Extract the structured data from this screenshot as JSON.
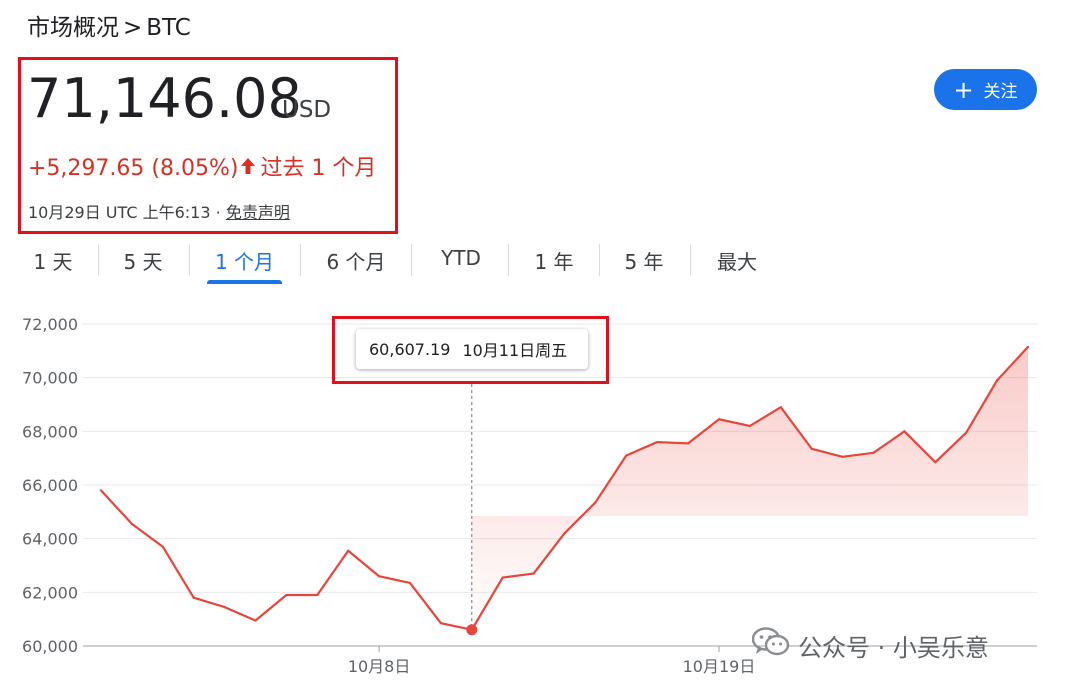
{
  "breadcrumb": {
    "parent": "市场概况",
    "separator": ">",
    "current": "BTC"
  },
  "quote": {
    "price": "71,146.08",
    "currency": "USD",
    "change": "+5,297.65 (8.05%)",
    "change_period": "过去 1 个月",
    "timestamp": "10月29日 UTC 上午6:13",
    "dot": "·",
    "disclaimer": "免责声明"
  },
  "follow_button": {
    "label": "关注"
  },
  "tabs": [
    {
      "label": "1 天",
      "active": false
    },
    {
      "label": "5 天",
      "active": false
    },
    {
      "label": "1 个月",
      "active": true
    },
    {
      "label": "6 个月",
      "active": false
    },
    {
      "label": "YTD",
      "active": false
    },
    {
      "label": "1 年",
      "active": false
    },
    {
      "label": "5 年",
      "active": false
    },
    {
      "label": "最大",
      "active": false
    }
  ],
  "tooltip": {
    "value": "60,607.19",
    "date": "10月11日周五"
  },
  "watermark": {
    "text": "公众号 · 小吴乐意"
  },
  "colors": {
    "line": "#e8453c",
    "accent": "#1a73e8",
    "highlight_box": "#e3101b",
    "negative": "#d93025"
  },
  "chart_data": {
    "type": "area",
    "ylim": [
      60000,
      72000
    ],
    "y_ticks": [
      "60,000",
      "62,000",
      "64,000",
      "66,000",
      "68,000",
      "70,000",
      "72,000"
    ],
    "x_tick_labels": [
      {
        "label": "10月8日",
        "x": "2024-10-08"
      },
      {
        "label": "10月19日",
        "x": "2024-10-19"
      }
    ],
    "x": [
      "2024-09-29",
      "2024-09-30",
      "2024-10-01",
      "2024-10-02",
      "2024-10-03",
      "2024-10-04",
      "2024-10-05",
      "2024-10-06",
      "2024-10-07",
      "2024-10-08",
      "2024-10-09",
      "2024-10-10",
      "2024-10-11",
      "2024-10-12",
      "2024-10-13",
      "2024-10-14",
      "2024-10-15",
      "2024-10-16",
      "2024-10-17",
      "2024-10-18",
      "2024-10-19",
      "2024-10-20",
      "2024-10-21",
      "2024-10-22",
      "2024-10-23",
      "2024-10-24",
      "2024-10-25",
      "2024-10-26",
      "2024-10-27",
      "2024-10-28",
      "2024-10-29"
    ],
    "values": [
      65800,
      64550,
      63700,
      61800,
      61450,
      60950,
      61900,
      61900,
      63550,
      62600,
      62350,
      60850,
      60607.19,
      62550,
      62700,
      64200,
      65350,
      67100,
      67600,
      67550,
      68450,
      68200,
      68900,
      67350,
      67050,
      67200,
      68000,
      66850,
      67950,
      69900,
      71146.08
    ],
    "highlight_index": 12,
    "grid": true
  }
}
